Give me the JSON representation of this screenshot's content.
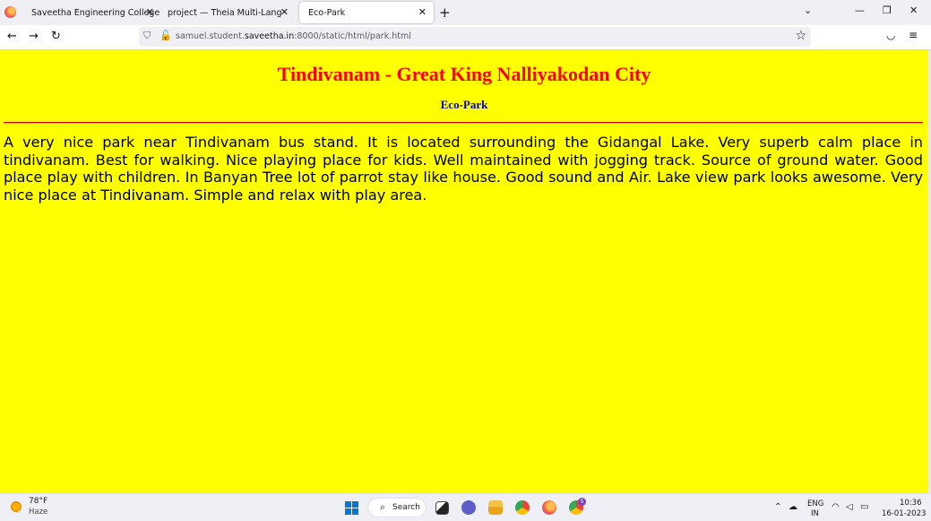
{
  "browser": {
    "tabs": [
      {
        "label": "Saveetha Engineering College"
      },
      {
        "label": "project — Theia Multi-Language Ex"
      },
      {
        "label": "Eco-Park"
      }
    ],
    "url_prefix": "samuel.student.",
    "url_domain": "saveetha.in",
    "url_suffix": ":8000/static/html/park.html"
  },
  "page": {
    "title": "Tindivanam - Great King Nalliyakodan City",
    "subtitle": "Eco-Park",
    "description": "A very nice park near Tindivanam bus stand. It is located surrounding the Gidangal Lake. Very superb calm place in tindivanam. Best for walking. Nice playing place for kids. Well maintained with jogging track. Source of ground water. Good place play with children. In Banyan Tree lot of parrot stay like house. Good sound and Air. Lake view park looks awesome. Very nice place at Tindivanam. Simple and relax with play area.",
    "colors": {
      "background": "#ffff00",
      "title": "#ff0000",
      "subtitle": "#0000c0"
    }
  },
  "taskbar": {
    "weather_temp": "78°F",
    "weather_cond": "Haze",
    "search_label": "Search",
    "lang_top": "ENG",
    "lang_bottom": "IN",
    "time": "10:36",
    "date": "16-01-2023",
    "notification_count": "5"
  }
}
